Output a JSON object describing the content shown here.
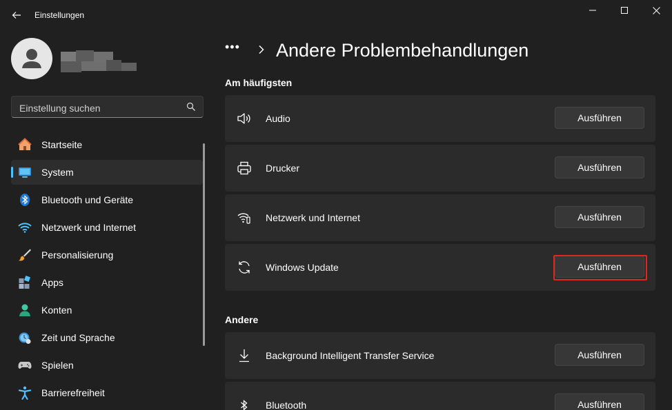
{
  "window": {
    "title": "Einstellungen"
  },
  "search": {
    "placeholder": "Einstellung suchen"
  },
  "sidebar": {
    "items": [
      {
        "label": "Startseite",
        "icon": "home-icon"
      },
      {
        "label": "System",
        "icon": "monitor-icon",
        "selected": true
      },
      {
        "label": "Bluetooth und Geräte",
        "icon": "bluetooth-icon"
      },
      {
        "label": "Netzwerk und Internet",
        "icon": "wifi-icon"
      },
      {
        "label": "Personalisierung",
        "icon": "brush-icon"
      },
      {
        "label": "Apps",
        "icon": "apps-icon"
      },
      {
        "label": "Konten",
        "icon": "account-icon"
      },
      {
        "label": "Zeit und Sprache",
        "icon": "clock-globe-icon"
      },
      {
        "label": "Spielen",
        "icon": "gamepad-icon"
      },
      {
        "label": "Barrierefreiheit",
        "icon": "accessibility-icon"
      }
    ]
  },
  "breadcrumb": {
    "more": "•••",
    "title": "Andere Problembehandlungen"
  },
  "sections": {
    "frequent": {
      "title": "Am häufigsten",
      "items": [
        {
          "label": "Audio",
          "icon": "speaker-icon",
          "button": "Ausführen"
        },
        {
          "label": "Drucker",
          "icon": "printer-icon",
          "button": "Ausführen"
        },
        {
          "label": "Netzwerk und Internet",
          "icon": "network-icon",
          "button": "Ausführen"
        },
        {
          "label": "Windows Update",
          "icon": "sync-icon",
          "button": "Ausführen"
        }
      ]
    },
    "other": {
      "title": "Andere",
      "items": [
        {
          "label": "Background Intelligent Transfer Service",
          "icon": "download-icon",
          "button": "Ausführen"
        },
        {
          "label": "Bluetooth",
          "icon": "bluetooth-icon",
          "button": "Ausführen"
        }
      ]
    }
  },
  "colors": {
    "accent": "#4cc2ff",
    "highlight": "#e0261f"
  }
}
